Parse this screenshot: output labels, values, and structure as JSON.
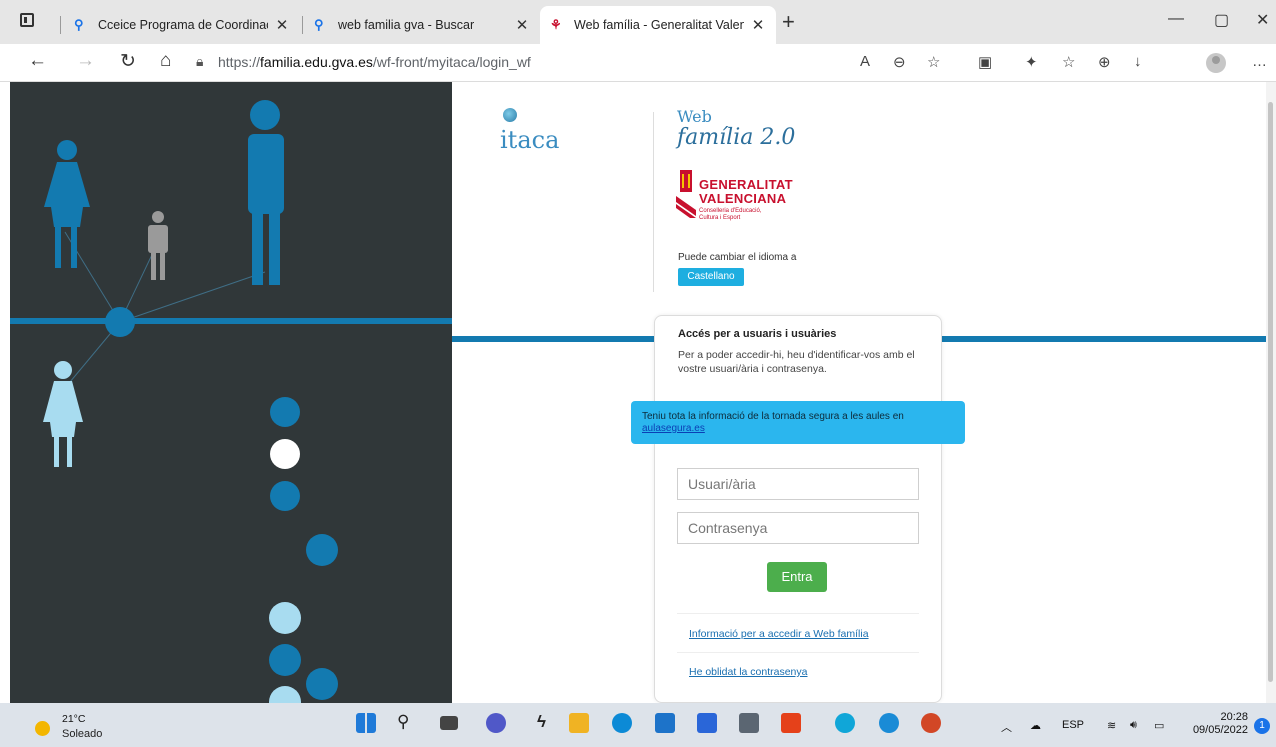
{
  "browser": {
    "tabs": [
      {
        "title": "Cceice Programa de Coordinació",
        "icon": "search-icon"
      },
      {
        "title": "web familia gva - Buscar",
        "icon": "search-icon"
      },
      {
        "title": "Web família - Generalitat Valenci",
        "icon": "generalitat-favicon"
      }
    ],
    "url_prefix": "https://",
    "url_domain": "familia.edu.gva.es",
    "url_path": "/wf-front/myitaca/login_wf"
  },
  "header": {
    "itaca": "itaca",
    "web_small": "Web",
    "web_big": "família 2.0",
    "gv_line1": "GENERALITAT",
    "gv_line2": "VALENCIANA",
    "gv_sub1": "Conselleria d'Educació,",
    "gv_sub2": "Cultura i Esport",
    "lang_prompt": "Puede cambiar el idioma a",
    "lang_button": "Castellano"
  },
  "login": {
    "title": "Accés per a usuaris i usuàries",
    "description": "Per a poder accedir-hi, heu d'identificar-vos amb el vostre usuari/ària i contrasenya.",
    "username_placeholder": "Usuari/ària",
    "password_placeholder": "Contrasenya",
    "submit": "Entra",
    "link_info": "Informació per a accedir a Web família",
    "link_forgot": "He oblidat la contrasenya"
  },
  "banner": {
    "text": "Teniu tota la informació de la tornada segura a les aules en ",
    "link": "aulasegura.es"
  },
  "taskbar": {
    "temp": "21°C",
    "weather": "Soleado",
    "lang": "ESP",
    "time": "20:28",
    "date": "09/05/2022",
    "notifications": "1"
  },
  "colors": {
    "accent_blue": "#137ab0",
    "panel_dark": "#303739",
    "button_green": "#4cae4c",
    "banner_cyan": "#2bb6ee",
    "gv_red": "#c8102e"
  }
}
